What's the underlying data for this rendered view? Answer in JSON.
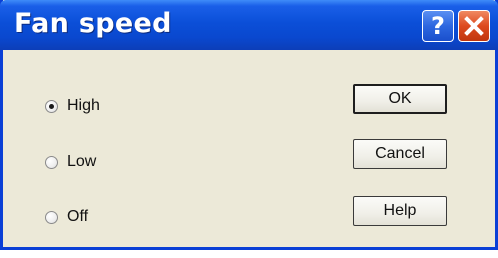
{
  "window": {
    "title": "Fan speed",
    "help_button_glyph": "?",
    "close_button_icon": "close-x-icon"
  },
  "options": {
    "items": [
      {
        "label": "High",
        "checked": true
      },
      {
        "label": "Low",
        "checked": false
      },
      {
        "label": "Off",
        "checked": false
      }
    ]
  },
  "buttons": {
    "ok": "OK",
    "cancel": "Cancel",
    "help": "Help"
  },
  "colors": {
    "titlebar": "#0b4fd8",
    "dialog_background": "#ece9d8",
    "close_button": "#dd4a1e"
  }
}
